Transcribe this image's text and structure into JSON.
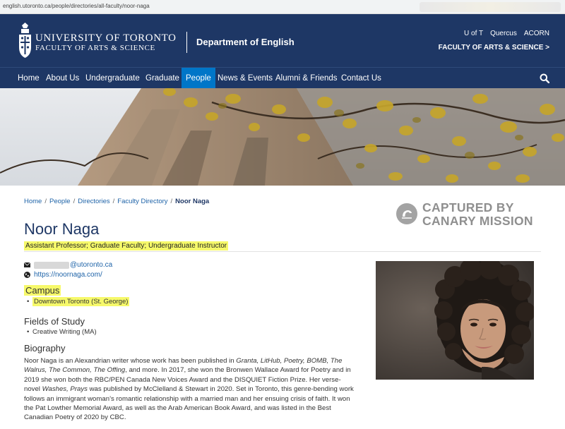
{
  "browser": {
    "url": "english.utoronto.ca/people/directories/all-faculty/noor-naga"
  },
  "header": {
    "university": "UNIVERSITY OF TORONTO",
    "faculty": "FACULTY OF ARTS & SCIENCE",
    "department": "Department of English",
    "util_links": [
      "U of T",
      "Quercus",
      "ACORN"
    ],
    "fas_link": "FACULTY OF ARTS & SCIENCE >"
  },
  "nav": {
    "items": [
      "Home",
      "About Us",
      "Undergraduate",
      "Graduate",
      "People",
      "News & Events",
      "Alumni & Friends",
      "Contact Us"
    ],
    "active": "People"
  },
  "breadcrumb": {
    "items": [
      "Home",
      "People",
      "Directories",
      "Faculty Directory"
    ],
    "separator": "/",
    "current": "Noor Naga"
  },
  "watermark": {
    "line1": "CAPTURED BY",
    "line2": "CANARY MISSION"
  },
  "profile": {
    "name": "Noor Naga",
    "titles": "Assistant Professor; Graduate Faculty; Undergraduate Instructor",
    "email_suffix": "@utoronto.ca",
    "website": "https://noornaga.com/",
    "campus_heading": "Campus",
    "campus": "Downtown Toronto (St. George)",
    "fields_heading": "Fields of Study",
    "fields": [
      "Creative Writing (MA)"
    ],
    "bio_heading": "Biography",
    "bio": {
      "p1": "Noor Naga is an Alexandrian writer whose work has been published in ",
      "p1_italic": "Granta, LitHub, Poetry, BOMB, The Walrus, The Common, The Offing",
      "p2": ", and more. In 2017, she won the Bronwen Wallace Award for Poetry and in 2019 she won both the RBC/PEN Canada New Voices Award and the DISQUIET Fiction Prize. Her verse-novel ",
      "p2_italic": "Washes, Prays",
      "p3": " was published by McClelland & Stewart in 2020. Set in Toronto, this genre-bending work follows an immigrant woman’s romantic relationship with a married man and her ensuing crisis of faith. It won the Pat Lowther Memorial Award, as well as the Arab American Book Award, and was listed in the Best Canadian Poetry of 2020 by CBC."
    }
  },
  "colors": {
    "brand_navy": "#1e3765",
    "nav_active": "#0076c8",
    "highlight": "#f6f96a",
    "link": "#1e63a8"
  }
}
